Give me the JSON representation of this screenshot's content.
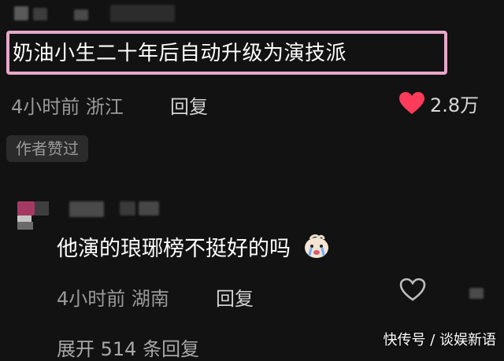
{
  "comment": {
    "text": "奶油小生二十年后自动升级为演技派",
    "time_location": "4小时前 浙江",
    "reply_label": "回复",
    "like_count": "2.8万",
    "author_liked_badge": "作者赞过"
  },
  "reply": {
    "text": "他演的琅琊榜不挺好的吗",
    "time_location": "4小时前 湖南",
    "reply_label": "回复"
  },
  "expand": {
    "label": "展开 514 条回复"
  },
  "watermark": {
    "text": "快传号 / 谈娱新语"
  },
  "colors": {
    "background": "#121212",
    "highlight_border": "#e7a8c9",
    "heart": "#ff3b5c"
  },
  "icons": {
    "like_filled": "heart-filled-icon",
    "like_outline": "heart-outline-icon",
    "reply_emoji": "crying-face-emoji"
  }
}
